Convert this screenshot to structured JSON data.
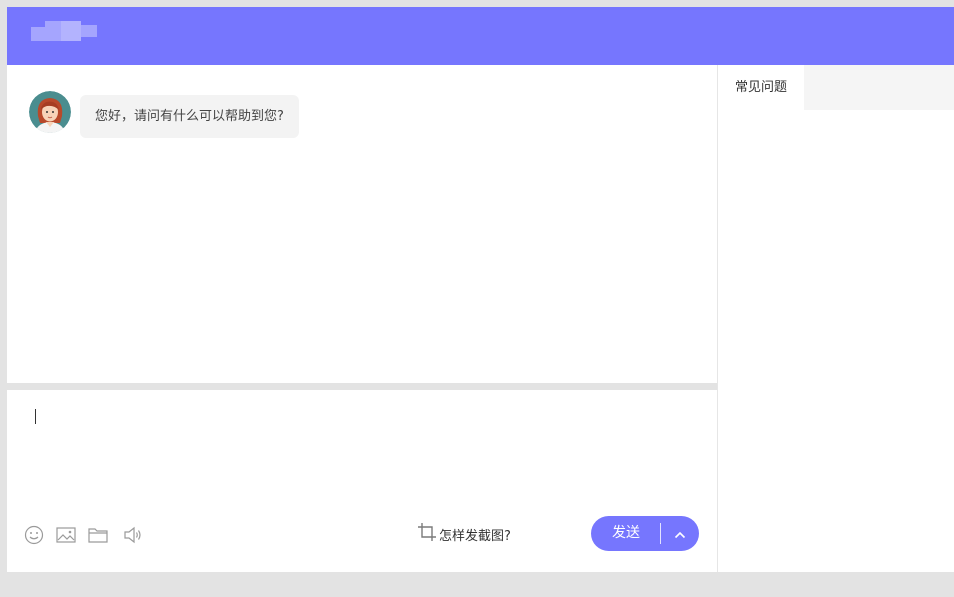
{
  "header": {
    "logo_icon": "blurred-logo"
  },
  "chat": {
    "messages": [
      {
        "sender": "agent",
        "avatar_icon": "agent-avatar",
        "text": "您好，请问有什么可以帮助到您?"
      }
    ]
  },
  "composer": {
    "input_value": "",
    "toolbar": {
      "emoji_icon": "smiley-icon",
      "image_icon": "image-icon",
      "file_icon": "folder-icon",
      "voice_icon": "speaker-icon"
    },
    "screenshot_help_label": "怎样发截图?",
    "send_label": "发送"
  },
  "side_panel": {
    "tabs": [
      {
        "label": "常见问题",
        "active": true
      }
    ]
  },
  "colors": {
    "accent": "#7676fe",
    "page_background": "#e3e3e3",
    "bubble_background": "#f3f3f3",
    "icon_gray": "#9a9a9a"
  }
}
